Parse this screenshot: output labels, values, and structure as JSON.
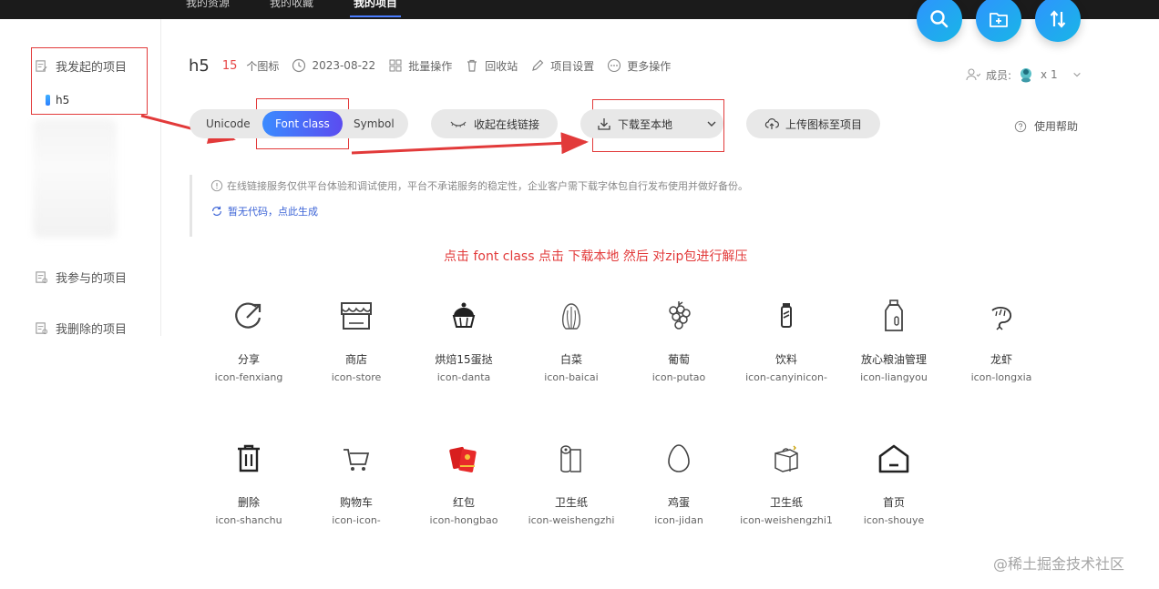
{
  "topnav": {
    "tabs": [
      "我的资源",
      "我的收藏",
      "我的项目"
    ],
    "active_index": 2
  },
  "fabs": [
    "search-icon",
    "add-folder-icon",
    "sort-icon"
  ],
  "sidebar": {
    "my_created": "我发起的项目",
    "current_project": "h5",
    "my_joined": "我参与的项目",
    "my_deleted": "我删除的项目"
  },
  "project": {
    "name": "h5",
    "count": "15",
    "count_unit": "个图标",
    "date": "2023-08-22",
    "batch": "批量操作",
    "recycle": "回收站",
    "settings": "项目设置",
    "more": "更多操作"
  },
  "members": {
    "label": "成员:",
    "count": "x 1"
  },
  "toolbar": {
    "tabs": [
      "Unicode",
      "Font class",
      "Symbol"
    ],
    "active_tab": "Font class",
    "collapse_link": "收起在线链接",
    "download": "下载至本地",
    "upload": "上传图标至项目",
    "help": "使用帮助"
  },
  "notice": {
    "text": "在线链接服务仅供平台体验和调试使用，平台不承诺服务的稳定性，企业客户需下载字体包自行发布使用并做好备份。",
    "generate": "暂无代码，点此生成"
  },
  "annotation": "点击 font class  点击 下载本地  然后 对zip包进行解压",
  "icons": [
    {
      "name": "分享",
      "cls": "icon-fenxiang",
      "glyph": "share-icon"
    },
    {
      "name": "商店",
      "cls": "icon-store",
      "glyph": "store-icon"
    },
    {
      "name": "烘焙15蛋挞",
      "cls": "icon-danta",
      "glyph": "cupcake-icon"
    },
    {
      "name": "白菜",
      "cls": "icon-baicai",
      "glyph": "cabbage-icon"
    },
    {
      "name": "葡萄",
      "cls": "icon-putao",
      "glyph": "grape-icon"
    },
    {
      "name": "饮料",
      "cls": "icon-canyinicon-",
      "glyph": "drink-icon"
    },
    {
      "name": "放心粮油管理",
      "cls": "icon-liangyou",
      "glyph": "oil-bottle-icon"
    },
    {
      "name": "龙虾",
      "cls": "icon-longxia",
      "glyph": "shrimp-icon"
    },
    {
      "name": "删除",
      "cls": "icon-shanchu",
      "glyph": "trash-icon"
    },
    {
      "name": "购物车",
      "cls": "icon-icon-",
      "glyph": "cart-icon"
    },
    {
      "name": "红包",
      "cls": "icon-hongbao",
      "glyph": "red-packet-icon"
    },
    {
      "name": "卫生纸",
      "cls": "icon-weishengzhi",
      "glyph": "tissue-roll-icon"
    },
    {
      "name": "鸡蛋",
      "cls": "icon-jidan",
      "glyph": "egg-icon"
    },
    {
      "name": "卫生纸",
      "cls": "icon-weishengzhi1",
      "glyph": "tissue-box-icon"
    },
    {
      "name": "首页",
      "cls": "icon-shouye",
      "glyph": "home-icon"
    }
  ],
  "watermark": "@稀土掘金技术社区",
  "colors": {
    "accent": "#3b8bff",
    "annotation": "#e23a3a",
    "count": "#e64545"
  }
}
